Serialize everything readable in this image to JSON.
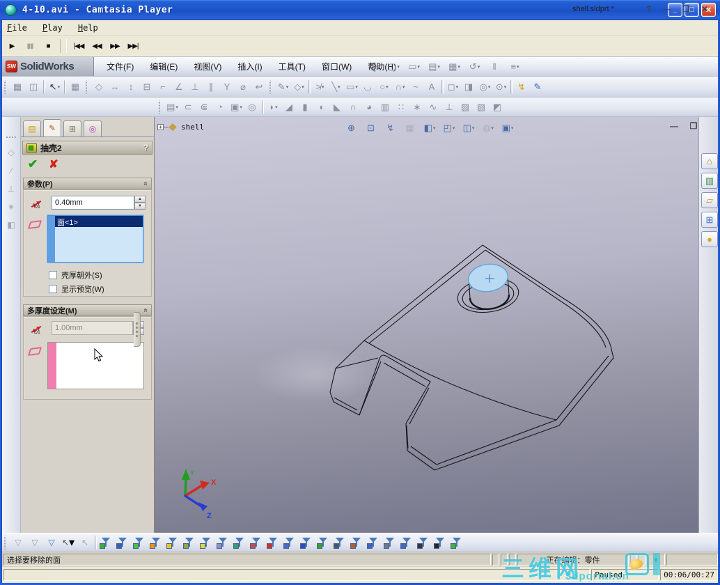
{
  "camtasia": {
    "window_title": "4-10.avi - Camtasia Player",
    "menu": [
      "File",
      "Play",
      "Help"
    ],
    "window_buttons": {
      "minimize": "_",
      "maximize": "□",
      "close": "✕"
    },
    "controls": [
      {
        "name": "play-button",
        "glyph": "▶"
      },
      {
        "name": "pause-button",
        "glyph": "▮▮",
        "cls": "dis"
      },
      {
        "name": "stop-button",
        "glyph": "■"
      },
      {
        "cls": "sep"
      },
      {
        "name": "skip-to-start-button",
        "glyph": "|◀◀"
      },
      {
        "name": "rewind-button",
        "glyph": "◀◀"
      },
      {
        "name": "fast-forward-button",
        "glyph": "▶▶"
      },
      {
        "name": "skip-to-end-button",
        "glyph": "▶▶|"
      }
    ],
    "progress_percent": 23,
    "status": "Paused",
    "time": "00:06/00:27"
  },
  "solidworks": {
    "brand": {
      "badge": "SW",
      "name": "SolidWorks"
    },
    "menus": [
      "文件(F)",
      "编辑(E)",
      "视图(V)",
      "插入(I)",
      "工具(T)",
      "窗口(W)",
      "帮助(H)"
    ],
    "doc_title": "shell.sldprt *",
    "help_button": "?",
    "window_buttons": {
      "minimize": "—",
      "restore": "❐",
      "close": "✕"
    },
    "std_toolbar": [
      {
        "name": "search-icon",
        "glyph": "Q",
        "fg": "#5a6070"
      },
      {
        "name": "new-document-icon",
        "glyph": "▢",
        "dd": "▾"
      },
      {
        "name": "open-document-icon",
        "glyph": "▭",
        "dd": "▾"
      },
      {
        "name": "save-icon",
        "glyph": "▤",
        "dd": "▾"
      },
      {
        "name": "print-icon",
        "glyph": "▦",
        "dd": "▾"
      },
      {
        "name": "undo-icon",
        "glyph": "↺",
        "dd": "▾"
      },
      {
        "name": "attachment-icon",
        "glyph": "ǁ"
      },
      {
        "name": "properties-icon",
        "glyph": "≡",
        "dd": "▾"
      }
    ],
    "toolbar_row2": [
      {
        "cls": "grip"
      },
      {
        "name": "window-split-icon",
        "glyph": "▦"
      },
      {
        "name": "isometric-box-icon",
        "glyph": "◫"
      },
      {
        "cls": "sep"
      },
      {
        "name": "select-arrow-icon",
        "glyph": "↖",
        "fg": "#333",
        "dd": "▾"
      },
      {
        "cls": "sep"
      },
      {
        "name": "grid-icon",
        "glyph": "▦"
      },
      {
        "cls": "grip"
      },
      {
        "name": "smart-dimension-icon",
        "glyph": "◇"
      },
      {
        "name": "horizontal-dimension-icon",
        "glyph": "↔"
      },
      {
        "name": "vertical-dimension-icon",
        "glyph": "↕"
      },
      {
        "name": "baseline-dimension-icon",
        "glyph": "⊟"
      },
      {
        "name": "ordinate-dimension-icon",
        "glyph": "⌐"
      },
      {
        "name": "chamfer-dimension-icon",
        "glyph": "∠"
      },
      {
        "name": "perpendicular-relation-icon",
        "glyph": "⊥"
      },
      {
        "name": "parallel-relation-icon",
        "glyph": "∥"
      },
      {
        "name": "vertical-relation-icon",
        "glyph": "Y"
      },
      {
        "name": "fix-relation-icon",
        "glyph": "⌀"
      },
      {
        "name": "display-relations-icon",
        "glyph": "↩"
      },
      {
        "cls": "grip"
      },
      {
        "name": "sketch-icon",
        "glyph": "✎",
        "dd": "▾"
      },
      {
        "name": "dimension-icon",
        "glyph": "◇",
        "dd": "▾"
      },
      {
        "cls": "sep"
      },
      {
        "name": "trim-entities-icon",
        "glyph": "≯",
        "dd": "▾"
      },
      {
        "name": "line-icon",
        "glyph": "╲",
        "dd": "▾"
      },
      {
        "name": "rectangle-icon",
        "glyph": "▭",
        "dd": "▾"
      },
      {
        "name": "arc-icon",
        "glyph": "◡"
      },
      {
        "name": "circle-icon",
        "glyph": "○",
        "dd": "▾"
      },
      {
        "name": "fillet-sketch-icon",
        "glyph": "∩",
        "dd": "▾"
      },
      {
        "name": "spline-icon",
        "glyph": "~"
      },
      {
        "name": "text-icon",
        "glyph": "A"
      },
      {
        "cls": "sep"
      },
      {
        "name": "box-3d-icon",
        "glyph": "◻",
        "dd": "▾"
      },
      {
        "name": "convert-entities-icon",
        "glyph": "◨"
      },
      {
        "name": "offset-entities-icon",
        "glyph": "◎",
        "dd": "▾"
      },
      {
        "name": "mirror-entities-icon",
        "glyph": "⊙",
        "dd": "▾"
      },
      {
        "cls": "sep"
      },
      {
        "name": "quick-snaps-icon",
        "glyph": "↯",
        "fg": "#d79b00"
      },
      {
        "name": "3d-sketch-icon",
        "glyph": "✎",
        "fg": "#2f6fc4"
      }
    ],
    "toolbar_features": [
      {
        "cls": "grip"
      },
      {
        "name": "extruded-boss-icon",
        "glyph": "▤",
        "dd": "▾"
      },
      {
        "name": "revolved-boss-icon",
        "glyph": "⊂"
      },
      {
        "name": "swept-boss-icon",
        "glyph": "⋐"
      },
      {
        "name": "lofted-boss-icon",
        "glyph": "◔"
      },
      {
        "name": "extruded-cut-icon",
        "glyph": "▣",
        "dd": "▾"
      },
      {
        "name": "hole-wizard-icon",
        "glyph": "◎"
      },
      {
        "cls": "sep"
      },
      {
        "name": "fillet-feature-icon",
        "glyph": "◗",
        "dd": "▾"
      },
      {
        "name": "chamfer-feature-icon",
        "glyph": "◢"
      },
      {
        "name": "rib-icon",
        "glyph": "▮"
      },
      {
        "name": "shell-feature-icon",
        "glyph": "◖"
      },
      {
        "name": "draft-icon",
        "glyph": "◣"
      },
      {
        "name": "dome-icon",
        "glyph": "∩"
      },
      {
        "name": "shape-icon",
        "glyph": "◕"
      },
      {
        "name": "mirror-feature-icon",
        "glyph": "▥"
      },
      {
        "name": "linear-pattern-icon",
        "glyph": "∷"
      },
      {
        "name": "circular-pattern-icon",
        "glyph": "∗"
      },
      {
        "name": "curve-icon",
        "glyph": "∿"
      },
      {
        "name": "reference-geometry-icon",
        "glyph": "⊥"
      },
      {
        "name": "instant3d-icon",
        "glyph": "▨"
      },
      {
        "name": "sheet-metal-icon",
        "glyph": "▧"
      },
      {
        "name": "surfaces-icon",
        "glyph": "◩"
      }
    ],
    "left_rail": [
      {
        "name": "reference-plane-icon",
        "glyph": "◇"
      },
      {
        "name": "reference-axis-icon",
        "glyph": "∕"
      },
      {
        "name": "coordinate-system-icon",
        "glyph": "⊥"
      },
      {
        "name": "reference-point-icon",
        "glyph": "∗"
      },
      {
        "name": "ruled-surface-icon",
        "glyph": "◧"
      }
    ],
    "property_manager": {
      "tabs": [
        {
          "name": "tab-feature-manager",
          "glyph": "▤",
          "fg": "#c8a020"
        },
        {
          "name": "tab-property-manager",
          "glyph": "✎",
          "fg": "#b06020",
          "cls": "active"
        },
        {
          "name": "tab-configuration-manager",
          "glyph": "⊞",
          "fg": "#777"
        },
        {
          "name": "tab-third-party",
          "glyph": "◎",
          "fg": "#b040c0"
        }
      ],
      "title": "抽壳2",
      "help": "?",
      "group1": {
        "title": "参数(P)",
        "d1_label": "D1",
        "thickness_value": "0.40mm",
        "selected_faces": [
          "面<1>"
        ],
        "checkbox1": "壳厚朝外(S)",
        "checkbox2": "显示预览(W)"
      },
      "group2": {
        "title": "多厚度设定(M)",
        "d1_label": "D1",
        "thickness_value": "1.00mm"
      }
    },
    "viewport": {
      "tree_expand": "+",
      "tree_label": "shell",
      "headsup": [
        {
          "name": "zoom-area-icon",
          "glyph": "⊕",
          "fg": "#4a6aa8"
        },
        {
          "name": "zoom-fit-icon",
          "glyph": "⊡",
          "fg": "#4a6aa8"
        },
        {
          "name": "view-settings-icon",
          "glyph": "↯",
          "fg": "#4a6aa8"
        },
        {
          "name": "hidden-lines-icon",
          "glyph": "▦",
          "fg": "#aab0bc"
        },
        {
          "name": "section-view-icon",
          "glyph": "◧",
          "fg": "#4a6aa8",
          "dd": "▾"
        },
        {
          "name": "view-orientation-icon",
          "glyph": "◰",
          "fg": "#4a6aa8",
          "dd": "▾"
        },
        {
          "name": "display-style-icon",
          "glyph": "◫",
          "fg": "#4a6aa8",
          "dd": "▾"
        },
        {
          "name": "appearance-icon",
          "glyph": "◍",
          "fg": "#aab0bc",
          "dd": "▾"
        },
        {
          "name": "scene-icon",
          "glyph": "▣",
          "fg": "#4a6aa8",
          "dd": "▾"
        }
      ],
      "window_buttons": {
        "minimize": "—",
        "restore": "❐",
        "close": "✕"
      },
      "triad": {
        "x": "X",
        "y": "Y",
        "z": "Z"
      }
    },
    "taskpane": [
      {
        "name": "home-icon",
        "glyph": "⌂",
        "fg": "#b8860b"
      },
      {
        "name": "design-library-icon",
        "glyph": "▥",
        "fg": "#3a8a4a"
      },
      {
        "name": "file-explorer-icon",
        "glyph": "▱",
        "fg": "#c8992a"
      },
      {
        "name": "view-palette-icon",
        "glyph": "⊞",
        "fg": "#3a6ac8"
      },
      {
        "name": "solidworks-resources-icon",
        "glyph": "●",
        "fg": "#e0a818"
      }
    ],
    "filter_plain": [
      {
        "name": "clear-filter-icon",
        "glyph": "▽",
        "fg": "#9aa2ae"
      },
      {
        "name": "toggle-filter-icon",
        "glyph": "▽",
        "fg": "#8a94a4"
      },
      {
        "name": "multi-filter-icon",
        "glyph": "▽",
        "fg": "#3a6ac8"
      },
      {
        "name": "select-tool-icon",
        "glyph": "↖",
        "fg": "#39425a",
        "dd": "▾"
      },
      {
        "name": "invert-selection-icon",
        "glyph": "↖",
        "fg": "#9aa2ae"
      }
    ],
    "filter_funnels": [
      {
        "name": "filter-vertices-icon",
        "color": "#35b235"
      },
      {
        "name": "filter-edges-icon",
        "color": "#2f62c8"
      },
      {
        "name": "filter-faces-icon",
        "color": "#44c444"
      },
      {
        "name": "filter-surface-bodies-icon",
        "color": "#e8941e"
      },
      {
        "name": "filter-solid-bodies-icon",
        "color": "#e4c832"
      },
      {
        "name": "filter-axes-icon",
        "color": "#86aa4e"
      },
      {
        "name": "filter-planes-icon",
        "color": "#d8d84a"
      },
      {
        "name": "filter-sketch-points-icon",
        "color": "#8d8dd0"
      },
      {
        "name": "filter-sketch-segments-icon",
        "color": "#2ea268"
      },
      {
        "name": "filter-midpoints-icon",
        "color": "#c84a4a"
      },
      {
        "name": "filter-center-marks-icon",
        "color": "#cc3333"
      },
      {
        "name": "filter-centerlines-icon",
        "color": "#4a6ac8"
      },
      {
        "name": "filter-dimensions-icon",
        "color": "#2a4ac8"
      },
      {
        "name": "filter-annotations-icon",
        "color": "#33a433"
      },
      {
        "name": "filter-notes-icon",
        "color": "#46586e"
      },
      {
        "name": "filter-balloons-icon",
        "color": "#b06030"
      },
      {
        "name": "filter-weld-symbols-icon",
        "color": "#3a66c2"
      },
      {
        "name": "filter-gtol-icon",
        "color": "#6a7890"
      },
      {
        "name": "filter-datums-icon",
        "color": "#3a6ac8"
      },
      {
        "name": "filter-surface-finish-icon",
        "color": "#303844"
      },
      {
        "name": "filter-cosmetic-threads-icon",
        "color": "#282828"
      },
      {
        "name": "filter-dowel-pins-icon",
        "color": "#3cb43c"
      }
    ],
    "statusbar": {
      "message": "选择要移除的面",
      "editing": "正在编辑：零件"
    }
  },
  "watermark": {
    "line1": "三维网",
    "line2": "3dportal.cn"
  }
}
